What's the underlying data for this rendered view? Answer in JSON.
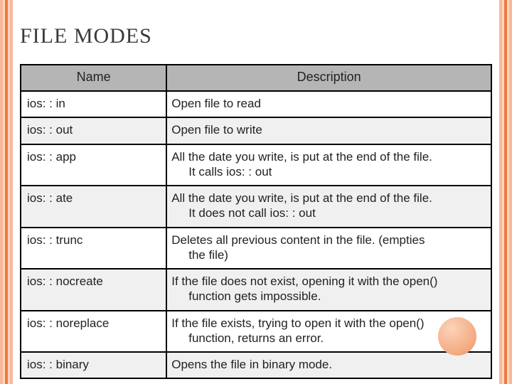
{
  "title": "FILE MODES",
  "headers": {
    "name": "Name",
    "desc": "Description"
  },
  "rows": [
    {
      "name": "ios: : in",
      "desc": "Open file to read",
      "cont": ""
    },
    {
      "name": "ios: : out",
      "desc": "Open file to write",
      "cont": ""
    },
    {
      "name": "ios: : app",
      "desc": "All the date you write, is put at the end of the file.",
      "cont": "It calls ios: : out"
    },
    {
      "name": "ios: : ate",
      "desc": "All the date you write, is put at the end of the file.",
      "cont": "It does not call ios: : out"
    },
    {
      "name": "ios: : trunc",
      "desc": "Deletes all previous content in the file. (empties",
      "cont": "the file)"
    },
    {
      "name": "ios: : nocreate",
      "desc": "If the file does not exist, opening it with the open()",
      "cont": "function gets impossible."
    },
    {
      "name": "ios: : noreplace",
      "desc": "If the file exists, trying to open it with the open()",
      "cont": "function, returns an error."
    },
    {
      "name": "ios: : binary",
      "desc": "Opens the file in binary mode.",
      "cont": ""
    }
  ]
}
